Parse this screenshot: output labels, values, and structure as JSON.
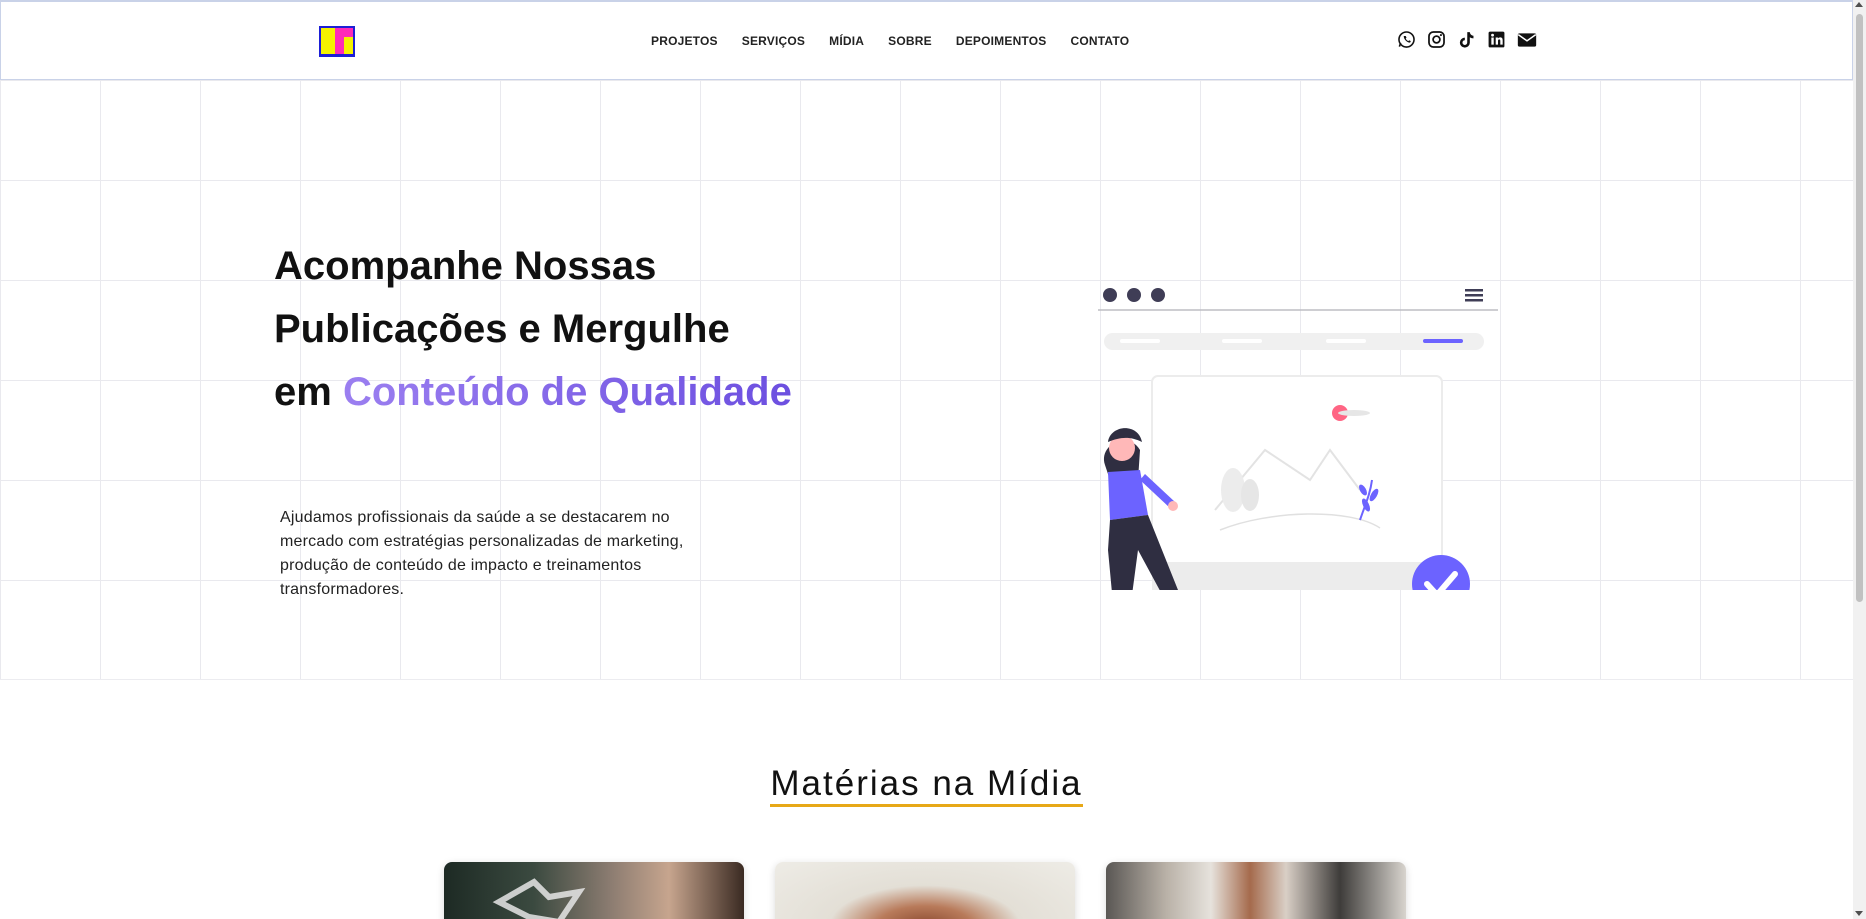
{
  "header": {
    "logo": "logo",
    "nav": [
      "PROJETOS",
      "SERVIÇOS",
      "MÍDIA",
      "SOBRE",
      "DEPOIMENTOS",
      "CONTATO"
    ],
    "socials": [
      "whatsapp-icon",
      "instagram-icon",
      "tiktok-icon",
      "linkedin-icon",
      "email-icon"
    ]
  },
  "hero": {
    "title_part1": "Acompanhe Nossas Publicações e Mergulhe em ",
    "title_accent": "Conteúdo de Qualidade",
    "description": "Ajudamos profissionais da saúde a se destacarem no mercado com estratégias personalizadas de marketing, produção de conteúdo de impacto e treinamentos transformadores."
  },
  "media": {
    "title": "Matérias na Mídia"
  },
  "colors": {
    "accent_start": "#9b7ff0",
    "accent_end": "#6c4fe0",
    "underline": "#e7a817",
    "illustration_purple": "#6c63ff",
    "illustration_dark": "#2f2e41"
  }
}
